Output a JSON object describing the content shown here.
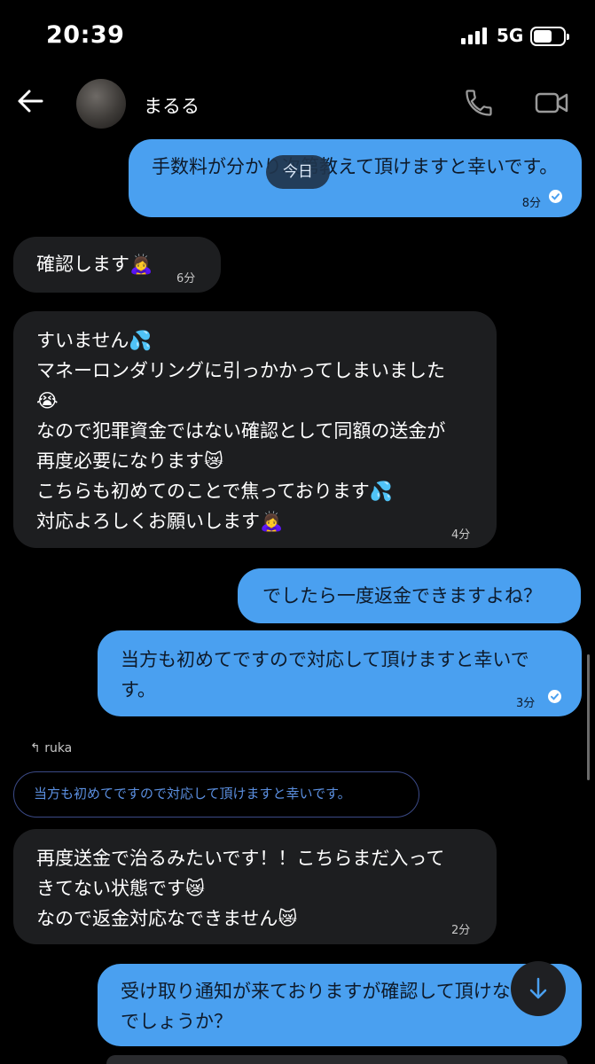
{
  "status_bar": {
    "time": "20:39",
    "network": "5G"
  },
  "header": {
    "contact_name": "まるる"
  },
  "date_chip": "今日",
  "messages": [
    {
      "dir": "out",
      "text": "手数料が分かり次第教えて頂けますと幸いです。",
      "time": "8分",
      "read": true
    },
    {
      "dir": "in",
      "text": "確認します🙇‍♀️",
      "time": "6分"
    },
    {
      "dir": "in",
      "text": "すいません💦\nマネーロンダリングに引っかかってしまいました\n😭\nなので犯罪資金ではない確認として同額の送金が\n再度必要になります😿\nこちらも初めてのことで焦っております💦\n対応よろしくお願いします🙇‍♀️",
      "time": "4分"
    },
    {
      "dir": "out",
      "text": "でしたら一度返金できますよね？"
    },
    {
      "dir": "out",
      "text": "当方も初めてですので対応して頂けますと幸いで\nす。",
      "time": "3分",
      "read": true
    },
    {
      "dir": "in",
      "reply_to": "ruka",
      "quoted": "当方も初めてですので対応して頂けますと幸いです。",
      "text": "再度送金で治るみたいです！！こちらまだ入って\nきてない状態です😿\nなので返金対応なできません😿",
      "time": "2分"
    },
    {
      "dir": "out",
      "text": "受け取り通知が来ておりますが確認して頂けない\nでしょうか？"
    }
  ],
  "icons": {
    "back": "arrow-left-icon",
    "call": "phone-icon",
    "video": "video-camera-icon",
    "read": "check-circle-icon",
    "reply": "reply-arrow-icon",
    "scroll_down": "arrow-down-icon"
  },
  "colors": {
    "outgoing_bubble": "#4aa0f0",
    "incoming_bubble": "#1d1e20",
    "background": "#000000",
    "reply_border": "#3b4a87",
    "reply_text": "#5b8fe0"
  }
}
